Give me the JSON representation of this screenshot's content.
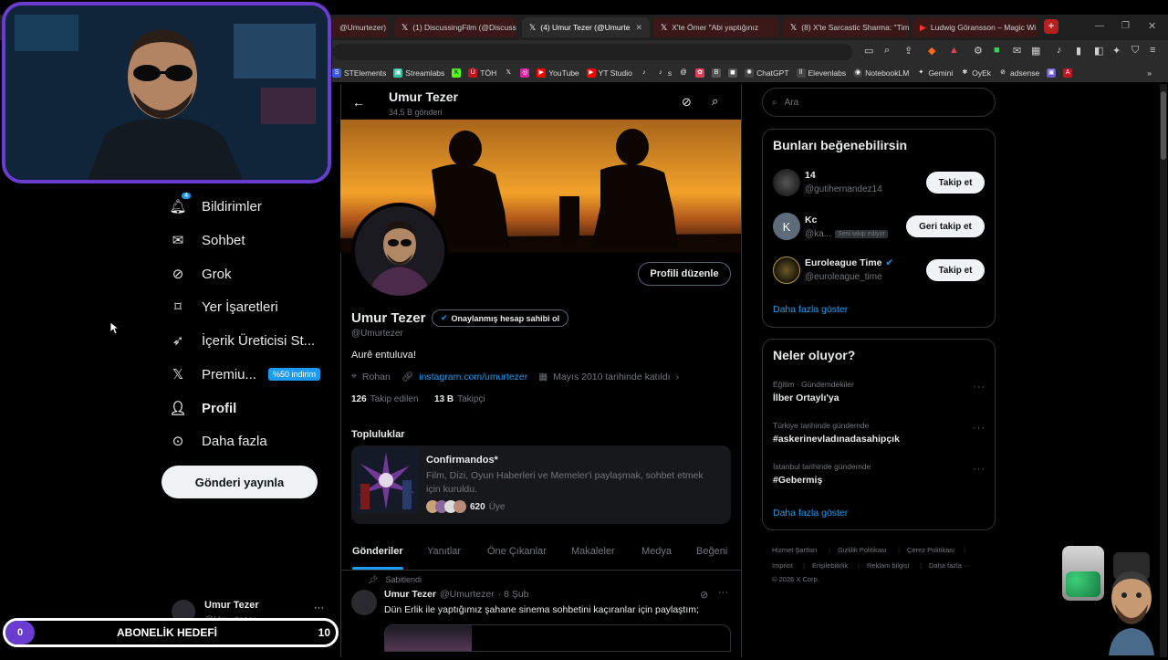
{
  "browser": {
    "tabs": [
      {
        "label": "@Umurtezer)"
      },
      {
        "label": "(1) DiscussingFilm (@Discussi"
      },
      {
        "label": "(4) Umur Tezer (@Umurte"
      },
      {
        "label": "X'te Ömer \"Abi yaptığınız"
      },
      {
        "label": "(8) X'te Sarcastic Sharma: \"Tim"
      },
      {
        "label": "Ludwig Göransson – Magic Wi"
      }
    ],
    "bookmarks": [
      "STElements",
      "Streamlabs",
      "TÖH",
      "YouTube",
      "YT Studio",
      "s",
      "ChatGPT",
      "Elevenlabs",
      "NotebookLM",
      "Gemini",
      "OyEk",
      "adsense"
    ]
  },
  "nav": {
    "items": [
      {
        "label": "Bildirimler",
        "icon": "bell-icon",
        "badge": "4"
      },
      {
        "label": "Sohbet",
        "icon": "mail-icon"
      },
      {
        "label": "Grok",
        "icon": "grok-icon"
      },
      {
        "label": "Yer İşaretleri",
        "icon": "bookmark-icon"
      },
      {
        "label": "İçerik Üreticisi St...",
        "icon": "rocket-icon"
      },
      {
        "label": "Premiu...",
        "icon": "x-logo-icon",
        "promo": "%50 indirim"
      },
      {
        "label": "Profil",
        "icon": "person-icon"
      },
      {
        "label": "Daha fazla",
        "icon": "more-circle-icon"
      }
    ],
    "post_button": "Gönderi yayınla",
    "account": {
      "name": "Umur Tezer",
      "handle": "@Umurtezer",
      "more": "···"
    }
  },
  "overlay": {
    "sub_goal_label": "ABONELİK HEDEFİ",
    "sub_current": "0",
    "sub_target": "10"
  },
  "profile": {
    "header_name": "Umur Tezer",
    "header_posts": "34,5 B gönderi",
    "edit_button": "Profili düzenle",
    "name": "Umur Tezer",
    "verify_label": "Onaylanmış hesap sahibi ol",
    "handle": "@Umurtezer",
    "bio": "Aurê entuluva!",
    "location": "Rohan",
    "website": "instagram.com/umurtezer",
    "joined": "Mayıs 2010 tarihinde katıldı",
    "following_count": "126",
    "following_label": "Takip edilen",
    "followers_count": "13 B",
    "followers_label": "Takipçi",
    "communities_title": "Topluluklar",
    "community": {
      "name": "Confirmandos*",
      "desc": "Film, Dizi, Oyun Haberleri ve Memeler'i paylaşmak, sohbet etmek için kuruldu.",
      "members_count": "620",
      "members_label": "Üye"
    },
    "tabs": [
      "Gönderiler",
      "Yanıtlar",
      "Öne Çıkanlar",
      "Makaleler",
      "Medya",
      "Beğeni"
    ],
    "pinned_label": "Sabitlendi",
    "post": {
      "name": "Umur Tezer",
      "handle": "@Umurtezer",
      "date": "· 8 Şub",
      "text": "Dün Erlik ile yaptığımız şahane sinema sohbetini kaçıranlar için paylaştım;"
    }
  },
  "sidebar": {
    "search_placeholder": "Ara",
    "suggest_title": "Bunları beğenebilirsin",
    "suggestions": [
      {
        "name": "14",
        "handle": "@gutihernandez14",
        "button": "Takip et"
      },
      {
        "name": "Kc",
        "handle": "@ka...",
        "note": "Seni takip ediyor",
        "button": "Geri takip et",
        "initial": "K"
      },
      {
        "name": "Euroleague Time",
        "handle": "@euroleague_time",
        "button": "Takip et"
      }
    ],
    "show_more": "Daha fazla göster",
    "trends_title": "Neler oluyor?",
    "trends": [
      {
        "context": "Eğitim · Gündemdekiler",
        "topic": "İlber Ortaylı'ya"
      },
      {
        "context": "Türkiye tarihinde gündemde",
        "topic": "#askerinevladınadasahipçık"
      },
      {
        "context": "İstanbul tarihinde gündemde",
        "topic": "#Gebermiş"
      }
    ],
    "trends_more": "Daha fazla göster",
    "footer": [
      "Hizmet Şartları",
      "Gizlilik Politikası",
      "Çerez Politikası",
      "Imprint",
      "Erişilebilirlik",
      "Reklam bilgisi",
      "Daha fazla ···",
      "© 2026 X Corp."
    ]
  },
  "colors": {
    "accent": "#1d9bf0",
    "overlay_purple": "#6a3ccf",
    "follow_btn": "#eff3f4"
  }
}
